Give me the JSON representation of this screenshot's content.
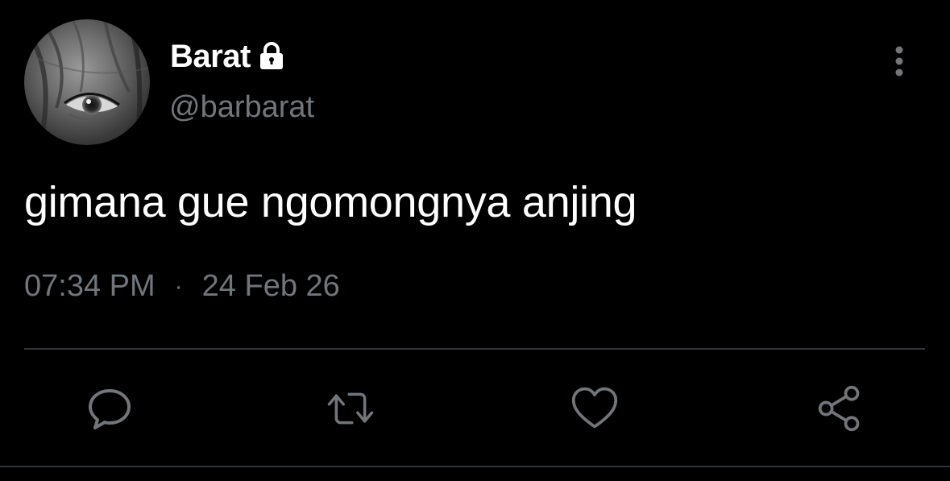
{
  "author": {
    "display_name": "Barat",
    "handle": "@barbarat",
    "protected": true
  },
  "tweet": {
    "text": "gimana gue ngomongnya anjing",
    "time": "07:34 PM",
    "separator": "·",
    "date": "24 Feb 26"
  },
  "actions": [
    {
      "name": "reply",
      "icon": "speech-bubble-icon"
    },
    {
      "name": "retweet",
      "icon": "retweet-arrows-icon"
    },
    {
      "name": "like",
      "icon": "heart-icon"
    },
    {
      "name": "share",
      "icon": "share-nodes-icon"
    }
  ],
  "colors": {
    "background": "#000000",
    "primary_text": "#ffffff",
    "secondary_text": "#71767b",
    "divider": "#2f3336"
  }
}
